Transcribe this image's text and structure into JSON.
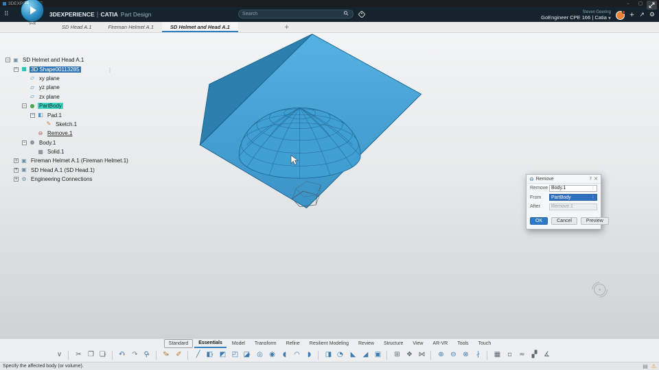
{
  "window": {
    "title": "3DEXPERIENCE",
    "controls": {
      "minimize": "–",
      "maximize": "▢",
      "close": "✕"
    }
  },
  "header": {
    "brand": "3DEXPERIENCE",
    "pipe": "|",
    "app": "CATIA",
    "module": "Part Design",
    "search": {
      "placeholder": "Search"
    },
    "user_name": "Steven Deering",
    "org": "GoEngineer CPE 166 | Catia",
    "org_caret": "▼",
    "compass": {
      "top": "3D",
      "vr": "V+R"
    },
    "icons": {
      "plus": "+",
      "share": "↗",
      "settings": "⚙"
    }
  },
  "doc_tabs": {
    "tabs": [
      {
        "label": "SD Head A.1"
      },
      {
        "label": "Fireman Helmet A.1"
      },
      {
        "label": "SD Helmet and Head A.1",
        "cls": "active"
      }
    ],
    "new_tab": "+"
  },
  "tree": {
    "items": [
      {
        "label": "SD Helmet and Head A.1",
        "depth": 0,
        "icon": "assembly-icon",
        "glyph": "▣",
        "color": "#6b8fa3",
        "expander": "−"
      },
      {
        "label": "3D Shape00113285",
        "depth": 1,
        "icon": "shape-icon",
        "glyph": "■",
        "color": "#2fc4b2",
        "expander": "−",
        "cls": "sel-blue"
      },
      {
        "label": "xy plane",
        "depth": 2,
        "icon": "plane-icon",
        "glyph": "▱",
        "color": "#4a8fc2"
      },
      {
        "label": "yz plane",
        "depth": 2,
        "icon": "plane-icon",
        "glyph": "▱",
        "color": "#4a8fc2"
      },
      {
        "label": "zx plane",
        "depth": 2,
        "icon": "plane-icon",
        "glyph": "▱",
        "color": "#4a8fc2"
      },
      {
        "label": "PartBody",
        "depth": 2,
        "icon": "partbody-icon",
        "glyph": "●",
        "color": "#49a84f",
        "expander": "−",
        "cls": "sel-teal"
      },
      {
        "label": "Pad.1",
        "depth": 3,
        "icon": "pad-icon",
        "glyph": "◧",
        "color": "#4a8fc2",
        "expander": "−"
      },
      {
        "label": "Sketch.1",
        "depth": 4,
        "icon": "sketch-icon",
        "glyph": "✎",
        "color": "#c47a2e"
      },
      {
        "label": "Remove.1",
        "depth": 3,
        "icon": "remove-icon",
        "glyph": "⊖",
        "color": "#b5524a",
        "cls": "underline"
      },
      {
        "label": "Body.1",
        "depth": 2,
        "icon": "body-icon",
        "glyph": "●",
        "color": "#8d97a0",
        "expander": "−"
      },
      {
        "label": "Solid.1",
        "depth": 3,
        "icon": "solid-icon",
        "glyph": "■",
        "color": "#8d97a0"
      },
      {
        "label": "Fireman Helmet A.1 (Fireman Helmet.1)",
        "depth": 1,
        "icon": "component-icon",
        "glyph": "▣",
        "color": "#6b8fa3",
        "expander": "+"
      },
      {
        "label": "SD Head A.1 (SD Head.1)",
        "depth": 1,
        "icon": "component-icon",
        "glyph": "▣",
        "color": "#6b8fa3",
        "expander": "+"
      },
      {
        "label": "Engineering Connections",
        "depth": 1,
        "icon": "connections-icon",
        "glyph": "⚙",
        "color": "#6b8fa3",
        "expander": "+"
      }
    ]
  },
  "dialog": {
    "title": "Remove",
    "title_icon": "⊖",
    "help": "?",
    "close": "✕",
    "fields": [
      {
        "label": "Remove",
        "value": "Body.1"
      },
      {
        "label": "From",
        "value": "PartBody"
      },
      {
        "label": "After",
        "value": "Remove.1"
      }
    ],
    "buttons": [
      "OK",
      "Cancel",
      "Preview"
    ]
  },
  "ribbon": {
    "tabs": [
      {
        "label": "Standard",
        "cls": "boxed"
      },
      {
        "label": "Essentials",
        "cls": "active"
      },
      {
        "label": "Model"
      },
      {
        "label": "Transform"
      },
      {
        "label": "Refine"
      },
      {
        "label": "Resilient Modeling"
      },
      {
        "label": "Review"
      },
      {
        "label": "Structure"
      },
      {
        "label": "View"
      },
      {
        "label": "AR-VR"
      },
      {
        "label": "Tools"
      },
      {
        "label": "Touch"
      }
    ],
    "icons": [
      {
        "name": "collapse-icon",
        "glyph": "∨",
        "color": "#666666"
      },
      {
        "cls": "sep"
      },
      {
        "name": "cut-icon",
        "glyph": "✂",
        "color": "#5c6670"
      },
      {
        "name": "copy-icon",
        "glyph": "❐",
        "color": "#5c6670"
      },
      {
        "name": "paste-icon",
        "glyph": "❏",
        "color": "#5c6670",
        "caret": "▾"
      },
      {
        "cls": "sep"
      },
      {
        "name": "undo-icon",
        "glyph": "↶",
        "color": "#3c7cb3",
        "caret": "▾"
      },
      {
        "name": "redo-icon",
        "glyph": "↷",
        "color": "#7d868d"
      },
      {
        "name": "zoom-icon",
        "glyph": "⚲",
        "color": "#3c7cb3",
        "caret": "▾"
      },
      {
        "cls": "sep"
      },
      {
        "name": "sketch-icon",
        "glyph": "✎",
        "color": "#bf7930",
        "caret": "▾"
      },
      {
        "name": "positioned-sketch-icon",
        "glyph": "✐",
        "color": "#bf7930"
      },
      {
        "cls": "sep"
      },
      {
        "name": "line-icon",
        "glyph": "╱",
        "color": "#3c7cb3"
      },
      {
        "name": "pad-icon",
        "glyph": "◧",
        "color": "#3c7cb3",
        "caret": "▾"
      },
      {
        "name": "drafted-pad-icon",
        "glyph": "◩",
        "color": "#3c7cb3"
      },
      {
        "name": "multi-pad-icon",
        "glyph": "◰",
        "color": "#3c7cb3"
      },
      {
        "name": "pocket-icon",
        "glyph": "◪",
        "color": "#3c7cb3",
        "caret": "▾"
      },
      {
        "name": "hole-icon",
        "glyph": "◎",
        "color": "#3c7cb3"
      },
      {
        "name": "shaft-icon",
        "glyph": "◉",
        "color": "#3c7cb3"
      },
      {
        "name": "groove-icon",
        "glyph": "◖",
        "color": "#3c7cb3"
      },
      {
        "name": "rib-icon",
        "glyph": "◠",
        "color": "#3c7cb3"
      },
      {
        "name": "slot-icon",
        "glyph": "◗",
        "color": "#3c7cb3"
      },
      {
        "cls": "sep"
      },
      {
        "name": "stiffener-icon",
        "glyph": "◨",
        "color": "#3c7cb3"
      },
      {
        "name": "fillet-icon",
        "glyph": "◔",
        "color": "#3c7cb3",
        "caret": "▾"
      },
      {
        "name": "chamfer-icon",
        "glyph": "◣",
        "color": "#3c7cb3"
      },
      {
        "name": "draft-icon",
        "glyph": "◢",
        "color": "#3c7cb3"
      },
      {
        "name": "shell-icon",
        "glyph": "▣",
        "color": "#3c7cb3"
      },
      {
        "cls": "sep"
      },
      {
        "name": "rect-pattern-icon",
        "glyph": "⊞",
        "color": "#5c6670"
      },
      {
        "name": "circular-pattern-icon",
        "glyph": "❖",
        "color": "#5c6670"
      },
      {
        "name": "mirror-icon",
        "glyph": "⋈",
        "color": "#5c6670"
      },
      {
        "cls": "sep"
      },
      {
        "name": "boolean-add-icon",
        "glyph": "⊕",
        "color": "#3c7cb3"
      },
      {
        "name": "boolean-remove-icon",
        "glyph": "⊖",
        "color": "#3c7cb3"
      },
      {
        "name": "boolean-intersect-icon",
        "glyph": "⊗",
        "color": "#3c7cb3"
      },
      {
        "name": "split-icon",
        "glyph": "∤",
        "color": "#3c7cb3"
      },
      {
        "cls": "sep"
      },
      {
        "name": "assemble-icon",
        "glyph": "▦",
        "color": "#5c6670"
      },
      {
        "name": "close-surface-icon",
        "glyph": "▫",
        "color": "#5c6670"
      },
      {
        "name": "sew-surface-icon",
        "glyph": "≈",
        "color": "#5c6670"
      },
      {
        "name": "section-icon",
        "glyph": "▞",
        "color": "#5c6670"
      },
      {
        "name": "measure-icon",
        "glyph": "∡",
        "color": "#5c6670"
      }
    ]
  },
  "status_bar": {
    "message": "Specify the affected body (or volume).",
    "icons": [
      {
        "name": "panel-icon",
        "glyph": "▤",
        "color": "#7d858c"
      },
      {
        "name": "warning-icon",
        "glyph": "⚠",
        "color": "#e0a023"
      }
    ]
  }
}
